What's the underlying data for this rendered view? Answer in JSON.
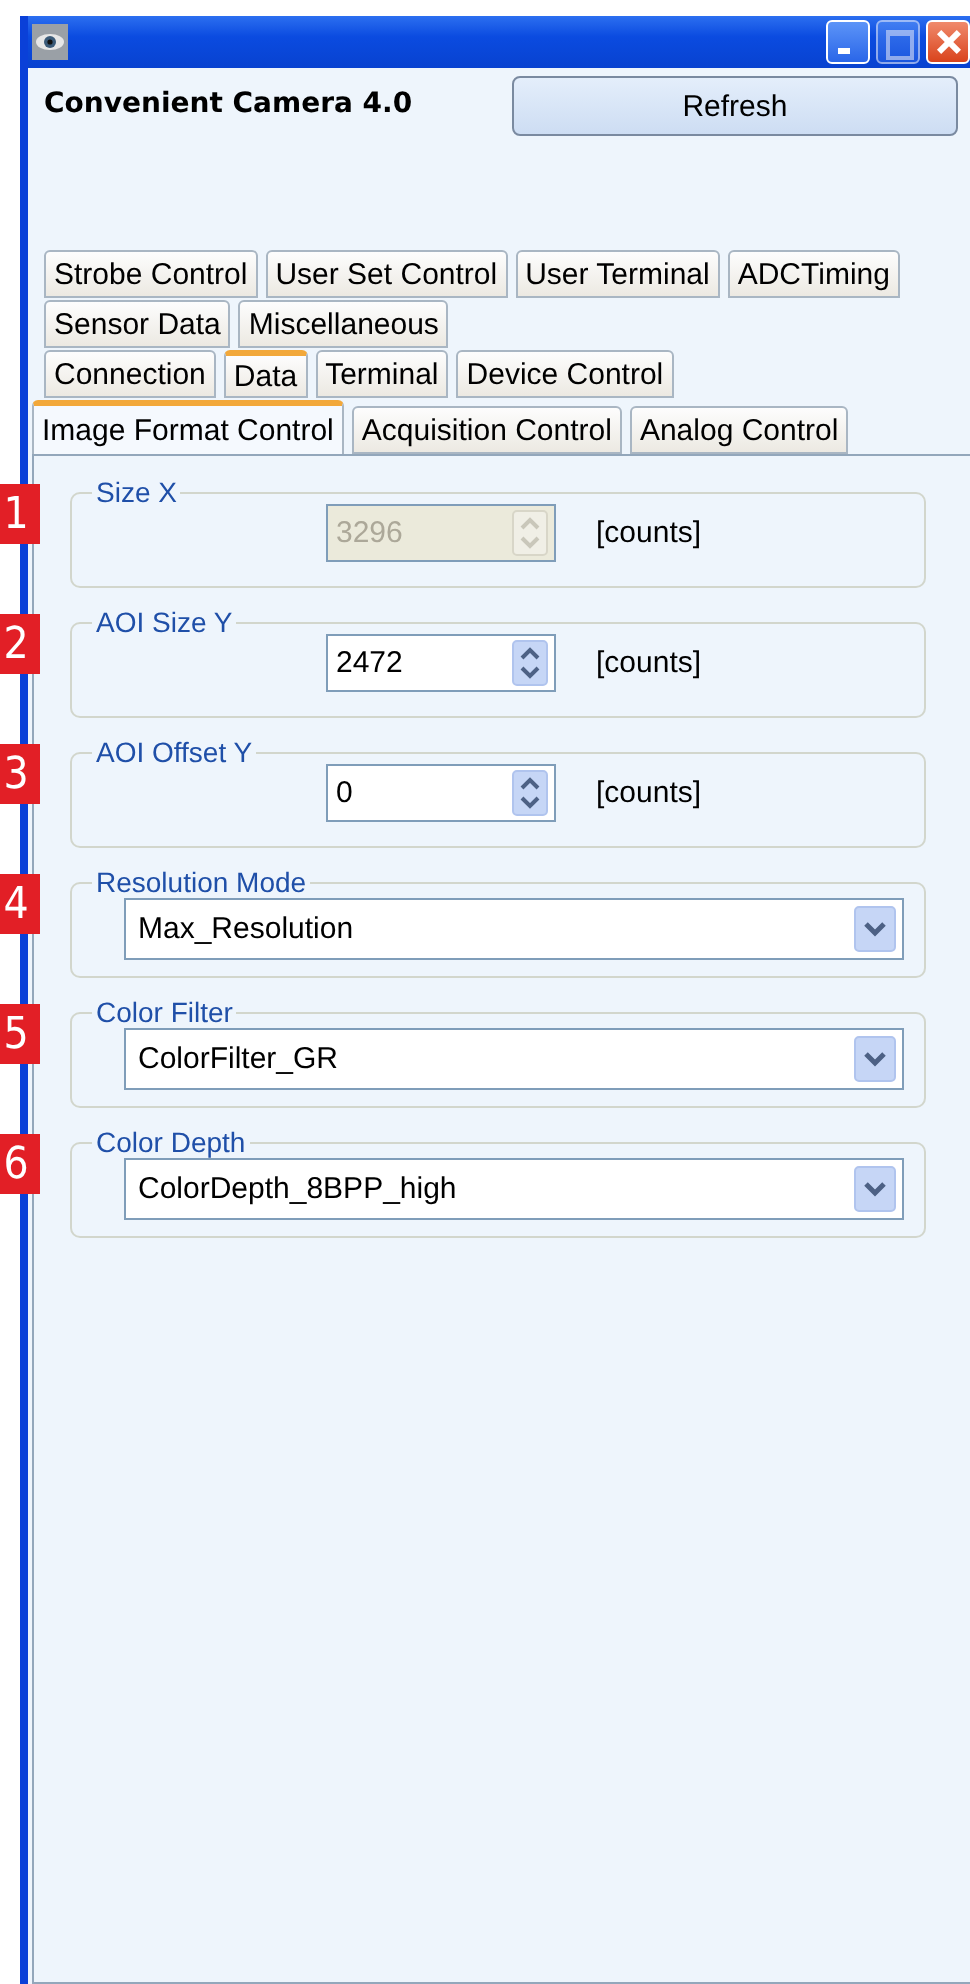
{
  "window": {
    "buttons": [
      {
        "kind": "minimize",
        "disabled": false
      },
      {
        "kind": "maximize",
        "disabled": true
      },
      {
        "kind": "close",
        "disabled": false
      }
    ]
  },
  "header": {
    "title": "Convenient Camera 4.0",
    "refresh_button": "Refresh"
  },
  "tab_rows": [
    [
      {
        "label": "Strobe Control",
        "selected": false,
        "highlighted": false
      },
      {
        "label": "User Set Control",
        "selected": false,
        "highlighted": false
      },
      {
        "label": "User Terminal",
        "selected": false,
        "highlighted": false
      },
      {
        "label": "ADCTiming",
        "selected": false,
        "highlighted": false
      }
    ],
    [
      {
        "label": "Sensor Data",
        "selected": false,
        "highlighted": false
      },
      {
        "label": "Miscellaneous",
        "selected": false,
        "highlighted": false
      }
    ],
    [
      {
        "label": "Connection",
        "selected": false,
        "highlighted": false
      },
      {
        "label": "Data",
        "selected": false,
        "highlighted": true
      },
      {
        "label": "Terminal",
        "selected": false,
        "highlighted": false
      },
      {
        "label": "Device Control",
        "selected": false,
        "highlighted": false
      }
    ],
    [
      {
        "label": "Image Format Control",
        "selected": true,
        "highlighted": true
      },
      {
        "label": "Acquisition Control",
        "selected": false,
        "highlighted": false
      },
      {
        "label": "Analog Control",
        "selected": false,
        "highlighted": false
      }
    ]
  ],
  "groups": [
    {
      "marker": "1",
      "legend": "Size X",
      "kind": "spin",
      "value": "3296",
      "unit": "[counts]",
      "disabled": true
    },
    {
      "marker": "2",
      "legend": "AOI Size Y",
      "kind": "spin",
      "value": "2472",
      "unit": "[counts]",
      "disabled": false
    },
    {
      "marker": "3",
      "legend": "AOI Offset Y",
      "kind": "spin",
      "value": "0",
      "unit": "[counts]",
      "disabled": false
    },
    {
      "marker": "4",
      "legend": "Resolution Mode",
      "kind": "dropdown",
      "value": "Max_Resolution"
    },
    {
      "marker": "5",
      "legend": "Color Filter",
      "kind": "dropdown",
      "value": "ColorFilter_GR"
    },
    {
      "marker": "6",
      "legend": "Color Depth",
      "kind": "dropdown",
      "value": "ColorDepth_8BPP_high"
    }
  ]
}
